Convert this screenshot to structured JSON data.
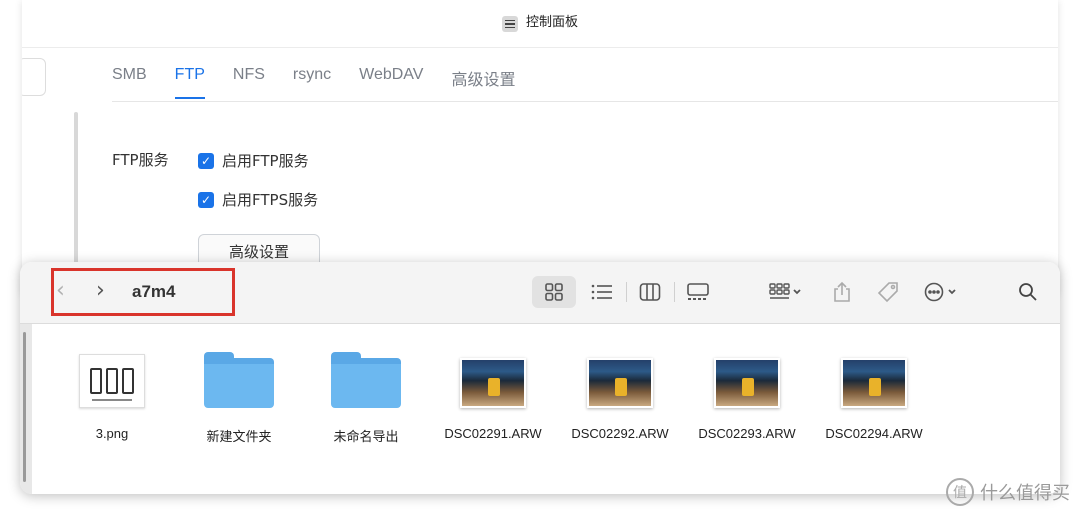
{
  "control_panel": {
    "title": "控制面板",
    "tabs": [
      {
        "label": "SMB",
        "active": false
      },
      {
        "label": "FTP",
        "active": true
      },
      {
        "label": "NFS",
        "active": false
      },
      {
        "label": "rsync",
        "active": false
      },
      {
        "label": "WebDAV",
        "active": false
      },
      {
        "label": "高级设置",
        "active": false
      }
    ],
    "ftp_section_label": "FTP服务",
    "options": [
      {
        "label": "启用FTP服务",
        "checked": true
      },
      {
        "label": "启用FTPS服务",
        "checked": true
      }
    ],
    "advanced_button": "高级设置"
  },
  "finder": {
    "folder_name": "a7m4",
    "files": [
      {
        "name": "3.png",
        "kind": "image"
      },
      {
        "name": "新建文件夹",
        "kind": "folder"
      },
      {
        "name": "未命名导出",
        "kind": "folder"
      },
      {
        "name": "DSC02291.ARW",
        "kind": "photo"
      },
      {
        "name": "DSC02292.ARW",
        "kind": "photo"
      },
      {
        "name": "DSC02293.ARW",
        "kind": "photo"
      },
      {
        "name": "DSC02294.ARW",
        "kind": "photo"
      }
    ],
    "highlight_color": "#d9342b"
  },
  "watermark": {
    "text": "什么值得买",
    "icon": "值"
  },
  "colors": {
    "accent": "#1a73e8"
  }
}
